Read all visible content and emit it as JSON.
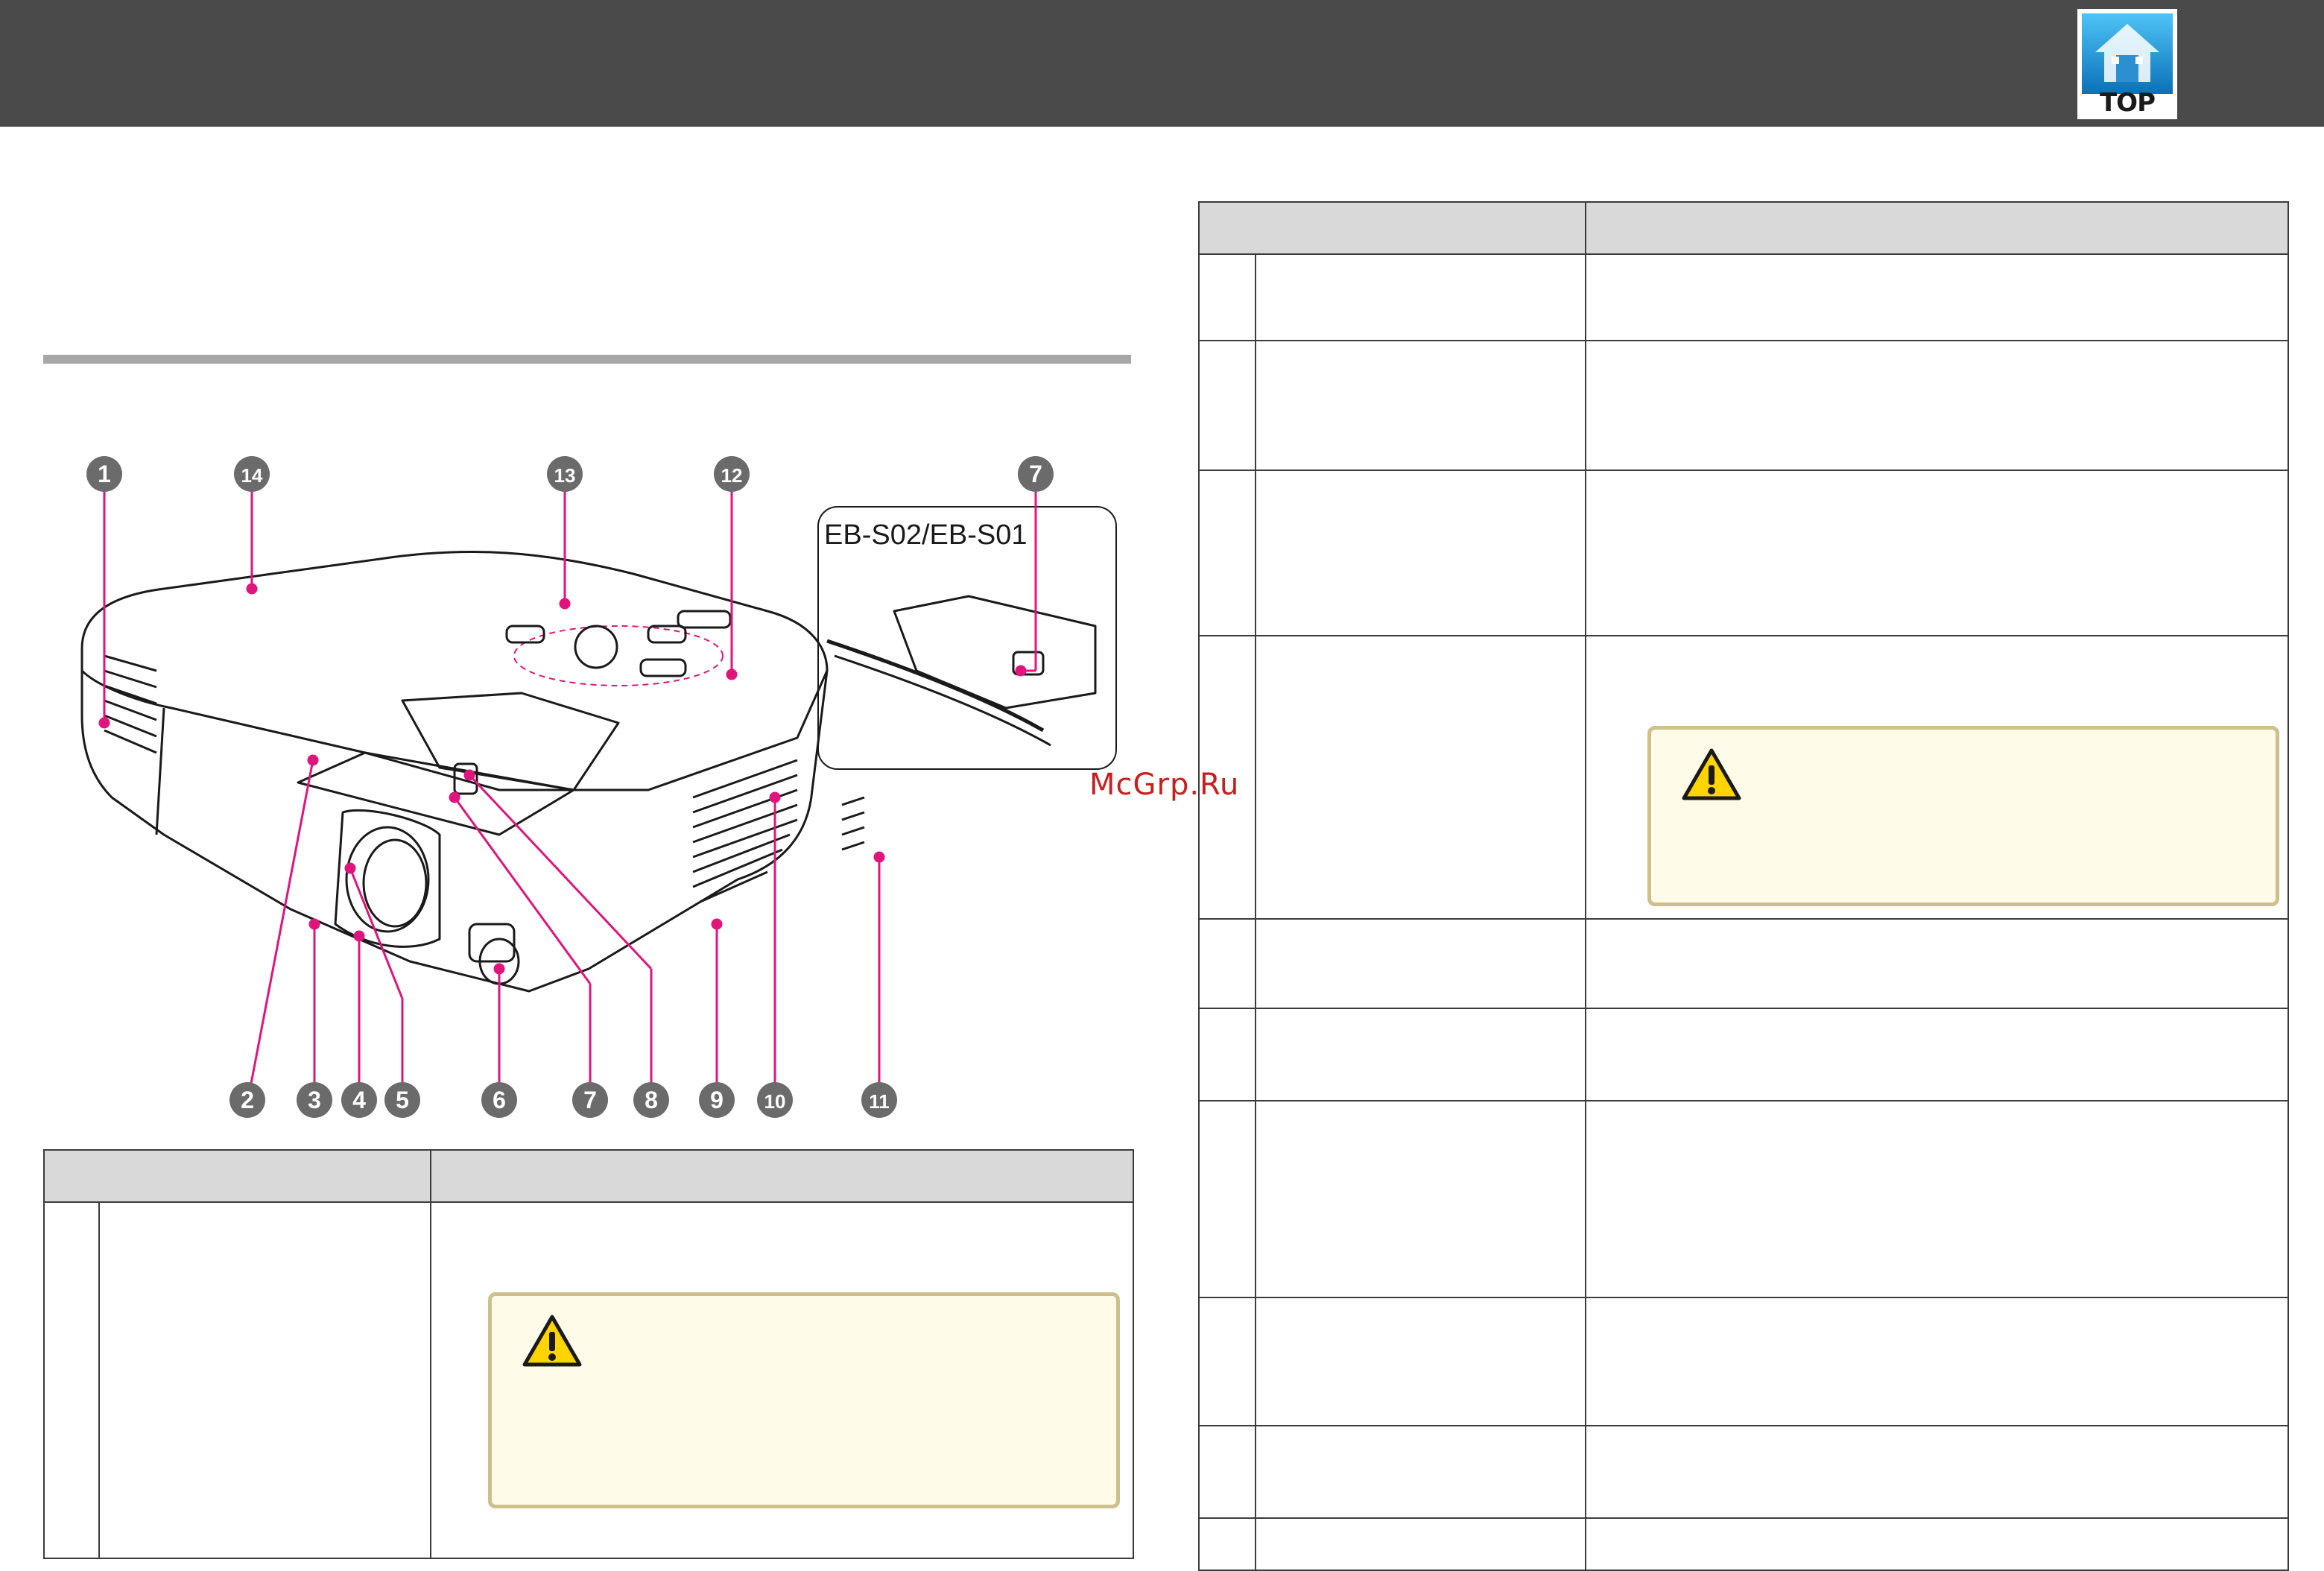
{
  "header": {
    "top_button_label": "TOP",
    "bar_color": "#4a4a4a"
  },
  "watermark": "McGrp.Ru",
  "illustration": {
    "inset_label": "EB-S02/EB-S01",
    "callouts": [
      "1",
      "2",
      "3",
      "4",
      "5",
      "6",
      "7",
      "8",
      "9",
      "10",
      "11",
      "12",
      "13",
      "14",
      "7"
    ],
    "callout_color": "#e0147c"
  },
  "left_table": {
    "header_cols": [
      "",
      ""
    ],
    "rows": [
      {
        "num": "",
        "name": "",
        "desc": "",
        "has_caution": true
      }
    ]
  },
  "right_table": {
    "header_cols": [
      "",
      ""
    ],
    "rows": [
      {
        "num": "",
        "name": "",
        "desc": ""
      },
      {
        "num": "",
        "name": "",
        "desc": ""
      },
      {
        "num": "",
        "name": "",
        "desc": ""
      },
      {
        "num": "",
        "name": "",
        "desc": "",
        "has_caution": true
      },
      {
        "num": "",
        "name": "",
        "desc": ""
      },
      {
        "num": "",
        "name": "",
        "desc": ""
      },
      {
        "num": "",
        "name": "",
        "desc": ""
      },
      {
        "num": "",
        "name": "",
        "desc": ""
      },
      {
        "num": "",
        "name": "",
        "desc": ""
      },
      {
        "num": "",
        "name": "",
        "desc": ""
      }
    ]
  },
  "colors": {
    "caution_fill": "#fefbe9",
    "caution_border": "#cdc08a",
    "table_header_fill": "#d9d9d9",
    "warning_yellow": "#ffd400"
  },
  "icons": [
    "home-icon",
    "warning-triangle-icon"
  ]
}
